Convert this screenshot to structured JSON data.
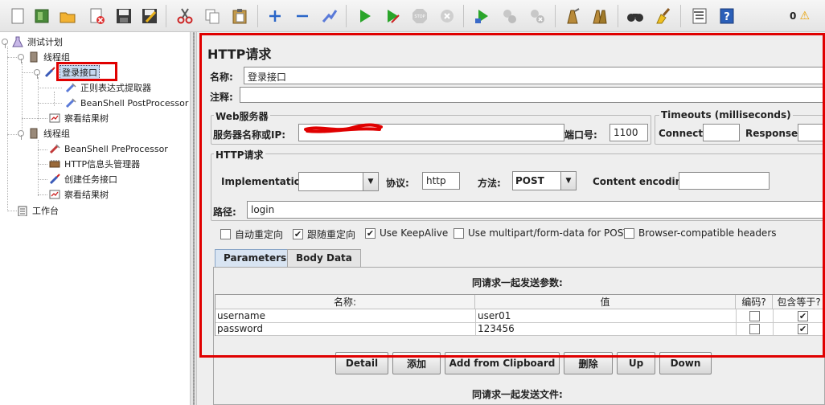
{
  "toolbar": {
    "icons": [
      "new-icon",
      "templates-icon",
      "open-icon",
      "close-icon",
      "save-icon",
      "save-as-icon",
      "cut-icon",
      "copy-icon",
      "paste-icon",
      "expand-icon",
      "collapse-icon",
      "toggle-icon",
      "start-icon",
      "start-no-pause-icon",
      "stop-icon",
      "shutdown-icon",
      "remote-start-icon",
      "remote-stop-icon",
      "remote-shutdown-icon",
      "clear-icon",
      "clear-all-icon",
      "search-icon",
      "reset-search-icon",
      "function-helper-icon",
      "help-icon"
    ],
    "warning_count": "0"
  },
  "tree": {
    "items": [
      {
        "label": "测试计划"
      },
      {
        "label": "线程组"
      },
      {
        "label": "登录接口"
      },
      {
        "label": "正则表达式提取器"
      },
      {
        "label": "BeanShell PostProcessor"
      },
      {
        "label": "察看结果树"
      },
      {
        "label": "线程组"
      },
      {
        "label": "BeanShell PreProcessor"
      },
      {
        "label": "HTTP信息头管理器"
      },
      {
        "label": "创建任务接口"
      },
      {
        "label": "察看结果树"
      },
      {
        "label": "工作台"
      }
    ]
  },
  "panel": {
    "title": "HTTP请求",
    "name_label": "名称:",
    "name_value": "登录接口",
    "comment_label": "注释:",
    "comment_value": "",
    "web_server": {
      "group_title": "Web服务器",
      "server_label": "服务器名称或IP:",
      "server_value": "",
      "port_label": "端口号:",
      "port_value": "1100"
    },
    "timeouts": {
      "group_title": "Timeouts (milliseconds)",
      "connect_label": "Connect:",
      "connect_value": "",
      "response_label": "Response:",
      "response_value": ""
    },
    "http_request": {
      "group_title": "HTTP请求",
      "implementation_label": "Implementation:",
      "implementation_value": "",
      "protocol_label": "协议:",
      "protocol_value": "http",
      "method_label": "方法:",
      "method_value": "POST",
      "encoding_label": "Content encoding:",
      "encoding_value": "",
      "path_label": "路径:",
      "path_value": "login"
    },
    "options": [
      {
        "label": "自动重定向",
        "checked": false
      },
      {
        "label": "跟随重定向",
        "checked": true
      },
      {
        "label": "Use KeepAlive",
        "checked": true
      },
      {
        "label": "Use multipart/form-data for POST",
        "checked": false
      },
      {
        "label": "Browser-compatible headers",
        "checked": false
      }
    ],
    "tabs": [
      {
        "label": "Parameters",
        "active": true
      },
      {
        "label": "Body Data",
        "active": false
      }
    ],
    "params_caption": "同请求一起发送参数:",
    "params_table": {
      "headers": [
        "名称:",
        "值",
        "编码?",
        "包含等于?"
      ],
      "rows": [
        {
          "name": "username",
          "value": "user01",
          "encode": false,
          "include_equals": true
        },
        {
          "name": "password",
          "value": "123456",
          "encode": false,
          "include_equals": true
        }
      ]
    },
    "buttons": [
      "Detail",
      "添加",
      "Add from Clipboard",
      "删除",
      "Up",
      "Down"
    ],
    "files_caption": "同请求一起发送文件:"
  }
}
